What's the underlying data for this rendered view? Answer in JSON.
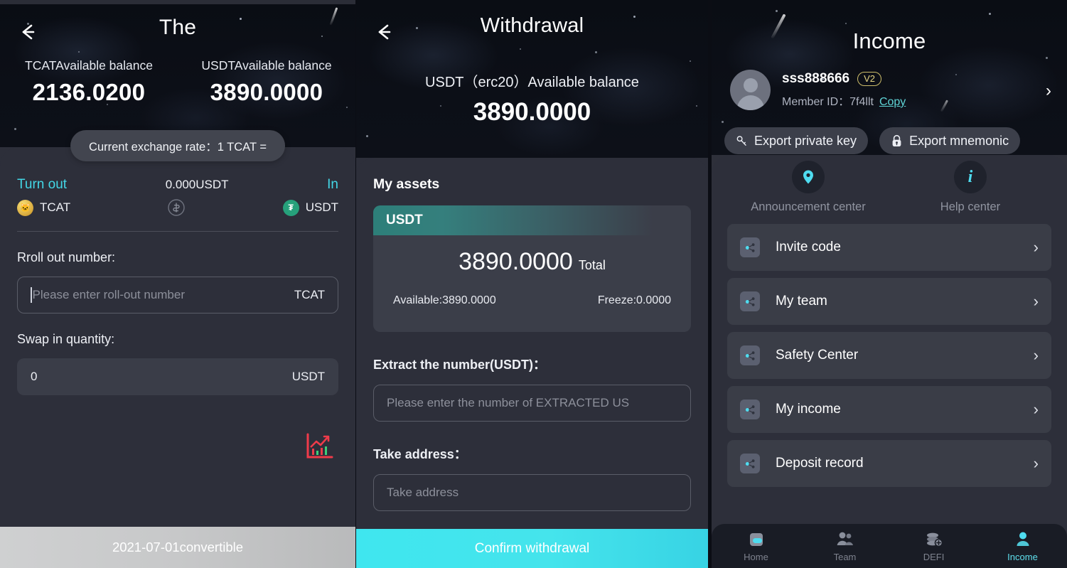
{
  "panel_swap": {
    "title": "The",
    "back_icon": "back-arrow-icon",
    "balances": [
      {
        "label": "TCATAvailable balance",
        "value": "2136.0200"
      },
      {
        "label": "USDTAvailable balance",
        "value": "3890.0000"
      }
    ],
    "rate_pill": "Current exchange rate：1 TCAT =",
    "swap": {
      "from_label": "Turn out",
      "middle_value": "0.000USDT",
      "to_label": "In",
      "from_coin": "TCAT",
      "to_coin": "USDT",
      "swap_icon": "swap-circle-icon"
    },
    "roll_out": {
      "label": "Rroll out number:",
      "placeholder": "Please enter roll-out number",
      "value": "",
      "suffix": "TCAT"
    },
    "swap_in": {
      "label": "Swap in quantity:",
      "placeholder": "",
      "value": "0",
      "suffix": "USDT"
    },
    "chart_icon": "market-chart-icon",
    "footer_button": "2021-07-01convertible"
  },
  "panel_withdrawal": {
    "title": "Withdrawal",
    "back_icon": "back-arrow-icon",
    "balance_label": "USDT（erc20）Available balance",
    "balance_value": "3890.0000",
    "my_assets_label": "My assets",
    "asset_card": {
      "symbol": "USDT",
      "total_value": "3890.0000",
      "total_label": "Total",
      "available": "Available:3890.0000",
      "freeze": "Freeze:0.0000"
    },
    "extract": {
      "label": "Extract the number(USDT)：",
      "placeholder": "Please enter the number of EXTRACTED US",
      "value": ""
    },
    "address": {
      "label": "Take address：",
      "placeholder": "Take address",
      "value": ""
    },
    "footer_button": "Confirm withdrawal"
  },
  "panel_income": {
    "title": "Income",
    "profile": {
      "avatar_icon": "avatar-icon",
      "username": "sss888666",
      "level_badge": "V2",
      "member_id_label": "Member ID：",
      "member_id": "7f4llt",
      "copy_label": "Copy",
      "chevron_icon": "chevron-right-icon"
    },
    "export_buttons": [
      {
        "label": "Export private key",
        "icon": "key-icon"
      },
      {
        "label": "Export mnemonic",
        "icon": "lock-icon"
      }
    ],
    "centers": [
      {
        "label": "Announcement center",
        "icon": "location-pin-icon"
      },
      {
        "label": "Help center",
        "icon": "info-icon"
      }
    ],
    "menu": [
      {
        "label": "Invite code",
        "icon": "share-nodes-icon"
      },
      {
        "label": "My team",
        "icon": "share-nodes-icon"
      },
      {
        "label": "Safety Center",
        "icon": "share-nodes-icon"
      },
      {
        "label": "My income",
        "icon": "share-nodes-icon"
      },
      {
        "label": "Deposit record",
        "icon": "share-nodes-icon"
      }
    ],
    "tabs": [
      {
        "label": "Home",
        "icon": "home-icon",
        "active": false
      },
      {
        "label": "Team",
        "icon": "team-icon",
        "active": false
      },
      {
        "label": "DEFI",
        "icon": "defi-coins-icon",
        "active": false
      },
      {
        "label": "Income",
        "icon": "income-person-icon",
        "active": true
      }
    ]
  },
  "colors": {
    "accent_cyan": "#43d7e6",
    "panel_bg": "#2d2f3a",
    "card_bg": "#3b3e49",
    "usdt_green": "#26a17b",
    "badge_gold": "#e4d483",
    "chart_red": "#ef3b4a"
  }
}
